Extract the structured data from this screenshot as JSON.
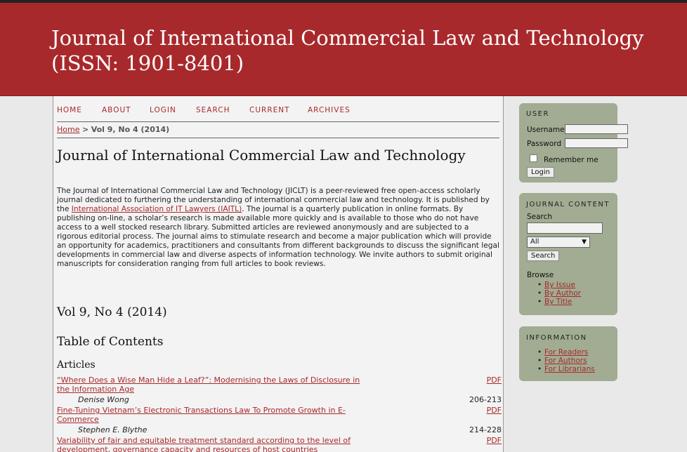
{
  "header": {
    "title": "Journal of International Commercial Law and Technology (ISSN: 1901-8401)"
  },
  "nav": {
    "items": [
      "HOME",
      "ABOUT",
      "LOGIN",
      "SEARCH",
      "CURRENT",
      "ARCHIVES"
    ]
  },
  "breadcrumb": {
    "home": "Home",
    "separator": ">",
    "current": "Vol 9, No 4 (2014)"
  },
  "main": {
    "title": "Journal of International Commercial Law and Technology",
    "description_pre": "The Journal of International Commercial Law and Technology (JICLT) is a peer-reviewed free open-access scholarly journal dedicated to furthering the understanding of international commercial law and technology. It is published by the ",
    "description_link": "International Association of IT Lawyers (IAITL)",
    "description_post": ". The journal is a quarterly publication in online formats. By publishing on-line, a scholar’s research is made available more quickly and is available to those who do not have access to a well stocked research library. Submitted articles are reviewed anonymously and are subjected to a rigorous editorial process. The journal aims to stimulate research and become a major publication which will provide an opportunity for academics, practitioners and consultants from different backgrounds to discuss the significant legal developments in commercial law and diverse aspects of information technology. We invite authors to submit original manuscripts for consideration ranging from full articles to book reviews.",
    "issue": "Vol 9, No 4 (2014)",
    "toc_title": "Table of Contents",
    "section": "Articles",
    "articles": [
      {
        "title": "“Where Does a Wise Man Hide a Leaf?”: Modernising the Laws of Disclosure in the Information Age",
        "pdf": "PDF",
        "author": "Denise Wong",
        "pages": "206-213"
      },
      {
        "title": "Fine-Tuning Vietnam’s Electronic Transactions Law To Promote Growth in E-Commerce",
        "pdf": "PDF",
        "author": "Stephen E. Blythe",
        "pages": "214-228"
      },
      {
        "title": "Variability of fair and equitable treatment standard according to the level of development, governance capacity and resources of host countries",
        "pdf": "PDF"
      }
    ]
  },
  "sidebar": {
    "user": {
      "title": "USER",
      "username_label": "Username",
      "password_label": "Password",
      "remember_label": "Remember me",
      "login_button": "Login"
    },
    "journal_content": {
      "title": "JOURNAL CONTENT",
      "search_label": "Search",
      "scope_selected": "All",
      "search_button": "Search",
      "browse_label": "Browse",
      "browse_items": [
        "By Issue",
        "By Author",
        "By Title"
      ]
    },
    "information": {
      "title": "INFORMATION",
      "items": [
        "For Readers",
        "For Authors",
        "For Librarians"
      ]
    }
  },
  "colors": {
    "header_bg": "#a8292c",
    "link": "#a8292c",
    "sidebar_block": "#a1ac92"
  }
}
